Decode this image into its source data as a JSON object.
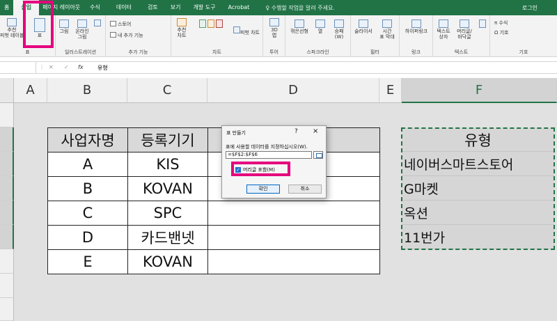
{
  "tabs": [
    "홈",
    "삽입",
    "페이지 레이아웃",
    "수식",
    "데이터",
    "검토",
    "보기",
    "개발 도구",
    "Acrobat"
  ],
  "tell_me": "수행할 작업을 알려 주세요.",
  "user": "로그인",
  "ribbon": {
    "pivot": "추천\n피벗 테이블",
    "table": "표",
    "pictures": "그림",
    "online_pictures": "온라인\n그림",
    "group_tables": "표",
    "group_illustrations": "일러스트레이션",
    "store": "스토어",
    "my_addins": "내 추가 기능",
    "group_addins": "추가 기능",
    "rec_charts": "추천\n차트",
    "pivot_chart": "피벗 차트",
    "group_charts": "차트",
    "map3d": "3D\n맵",
    "group_tours": "투어",
    "line": "꺾은선형",
    "column": "열",
    "winloss": "승패\n(W)",
    "group_sparklines": "스파크라인",
    "slicer": "슬라이서",
    "timeline": "시간\n표 막대",
    "group_filters": "필터",
    "hyperlink": "하이퍼링크",
    "group_links": "링크",
    "textbox": "텍스트\n상자",
    "header_footer": "머리글/\n바닥글",
    "group_text": "텍스트",
    "equation": "수식",
    "symbol": "기호",
    "group_symbols": "기호"
  },
  "formula_bar": {
    "fx": "fx",
    "content": "유형"
  },
  "columns": [
    "A",
    "B",
    "C",
    "D",
    "E",
    "F"
  ],
  "table": {
    "headers": [
      "사업자명",
      "등록기기"
    ],
    "rows": [
      [
        "A",
        "KIS"
      ],
      [
        "B",
        "KOVAN"
      ],
      [
        "C",
        "SPC"
      ],
      [
        "D",
        "카드밴넷"
      ],
      [
        "E",
        "KOVAN"
      ]
    ]
  },
  "column_f": {
    "header": "유형",
    "items": [
      "네이버스마트스토어",
      "G마켓",
      "옥션",
      "11번가"
    ]
  },
  "dialog": {
    "title": "표 만들기",
    "help": "?",
    "close": "×",
    "prompt": "표에 사용할 데이터를 지정하십시오(W).",
    "range": "=$F$2:$F$6",
    "checkbox_label": "머리글 포함(M)",
    "checkbox_checked": true,
    "ok": "확인",
    "cancel": "취소"
  },
  "colors": {
    "excel_green": "#217346",
    "highlight": "#e5007e"
  }
}
